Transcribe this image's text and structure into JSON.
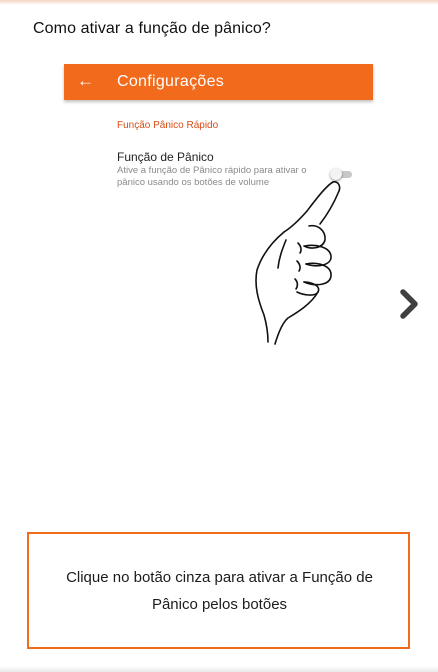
{
  "question": "Como ativar a função de pânico?",
  "screenshot": {
    "appbar": {
      "back_icon": "arrow-left-icon",
      "back_glyph": "←",
      "title": "Configurações"
    },
    "section_header": "Função Pânico Rápido",
    "setting": {
      "title": "Função de Pânico",
      "description": "Ative a função de Pânico rápido para ativar o pânico usando os botões de volume",
      "toggle_on": false
    }
  },
  "navigation": {
    "next_icon": "chevron-right-icon"
  },
  "instruction": "Clique no botão cinza para ativar a Função de Pânico pelos botões",
  "colors": {
    "brand_orange": "#f26a1b",
    "section_red": "#d84b14",
    "chevron_gray": "#404040"
  }
}
